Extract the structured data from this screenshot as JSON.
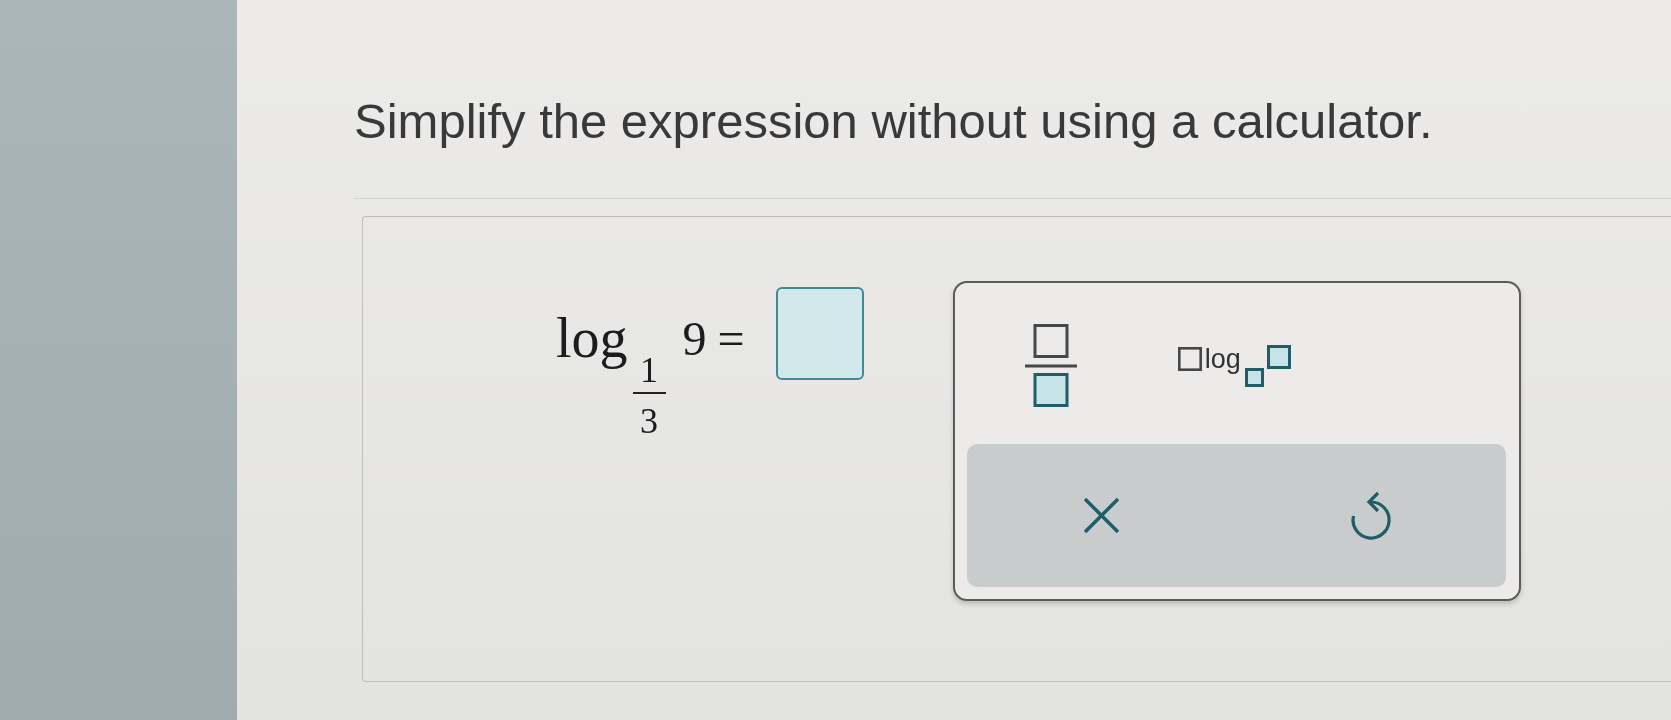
{
  "instruction": "Simplify the expression without using a calculator.",
  "expression": {
    "function": "log",
    "base": {
      "numerator": "1",
      "denominator": "3"
    },
    "argument": "9",
    "relation": "="
  },
  "palette": {
    "templates": [
      {
        "kind": "fraction"
      },
      {
        "kind": "logarithm",
        "label": "log"
      }
    ],
    "actions": [
      {
        "kind": "clear"
      },
      {
        "kind": "undo"
      }
    ]
  }
}
